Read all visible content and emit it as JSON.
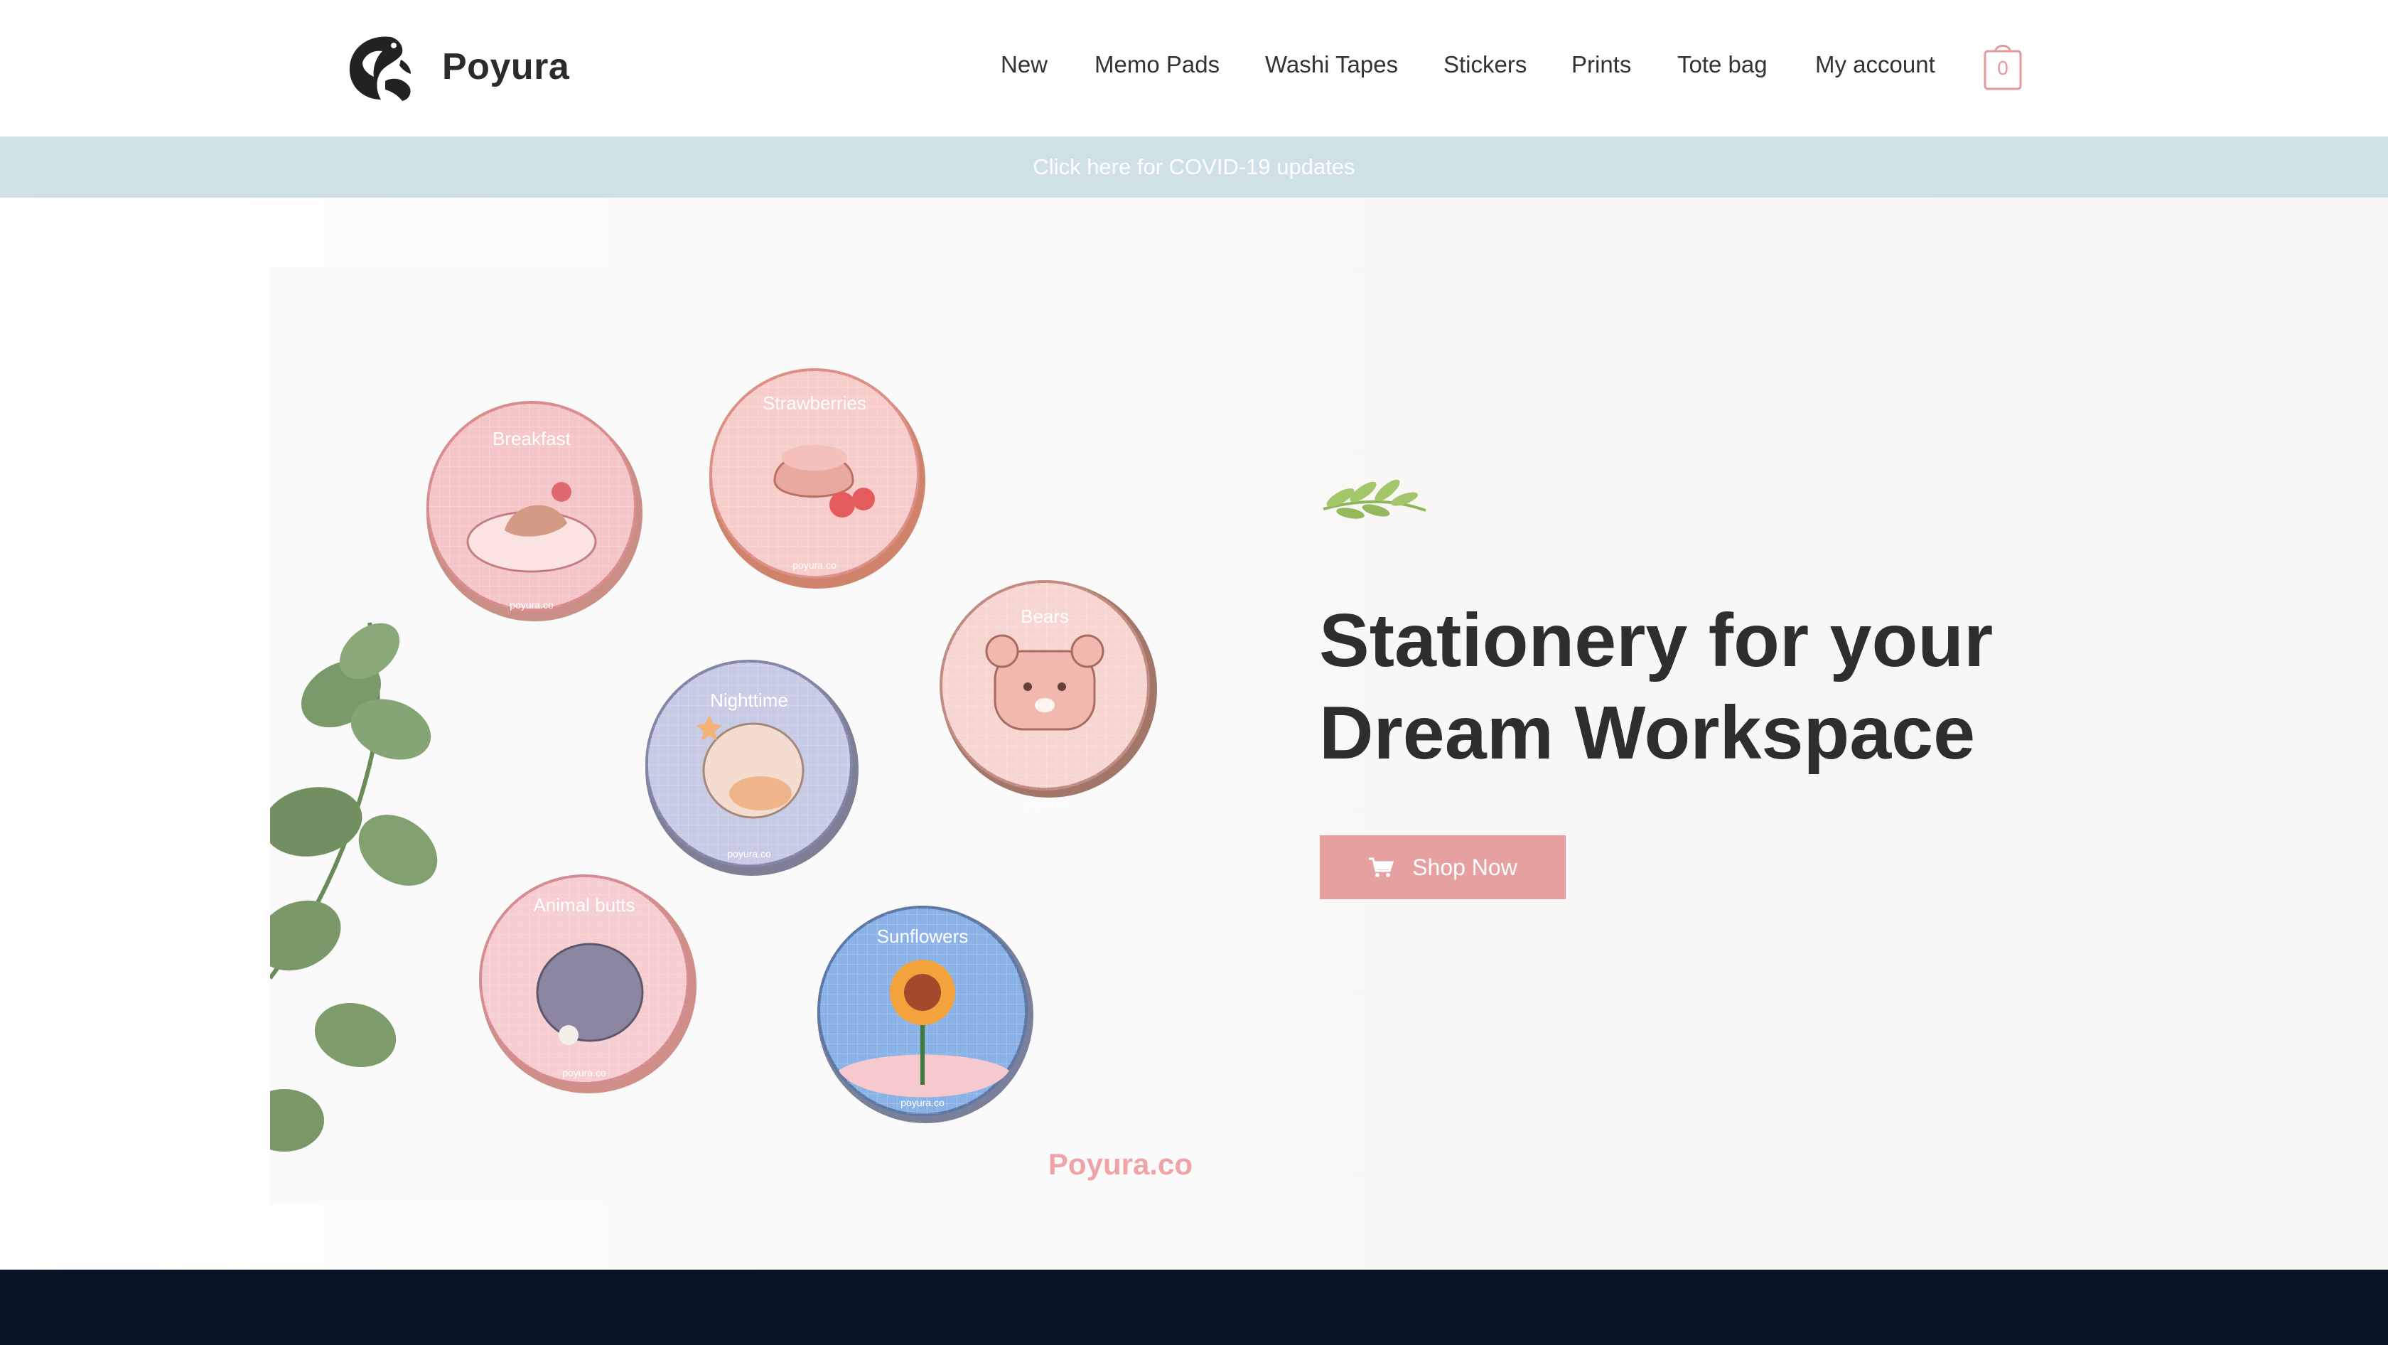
{
  "brand": {
    "name": "Poyura"
  },
  "nav": {
    "items": [
      {
        "label": "New"
      },
      {
        "label": "Memo Pads"
      },
      {
        "label": "Washi Tapes"
      },
      {
        "label": "Stickers"
      },
      {
        "label": "Prints"
      },
      {
        "label": "Tote bag"
      },
      {
        "label": "My account"
      }
    ]
  },
  "cart": {
    "count": "0",
    "icon": "shopping-bag-icon"
  },
  "notice": {
    "text": "Click here for COVID-19 updates"
  },
  "hero": {
    "title_line1": "Stationery for your",
    "title_line2": "Dream Workspace",
    "button_label": "Shop Now",
    "button_icon": "shopping-cart-icon",
    "watermark": "Poyura.co",
    "tapes": [
      {
        "label": "Breakfast"
      },
      {
        "label": "Strawberries"
      },
      {
        "label": "Bears"
      },
      {
        "label": "Nighttime"
      },
      {
        "label": "Animal butts"
      },
      {
        "label": "Sunflowers"
      }
    ],
    "tape_footer": "poyura.co"
  },
  "colors": {
    "accent": "#e7a0a0",
    "notice_bg": "#cfe0e6",
    "footer_bg": "#061423",
    "text_dark": "#2e2e2e"
  }
}
